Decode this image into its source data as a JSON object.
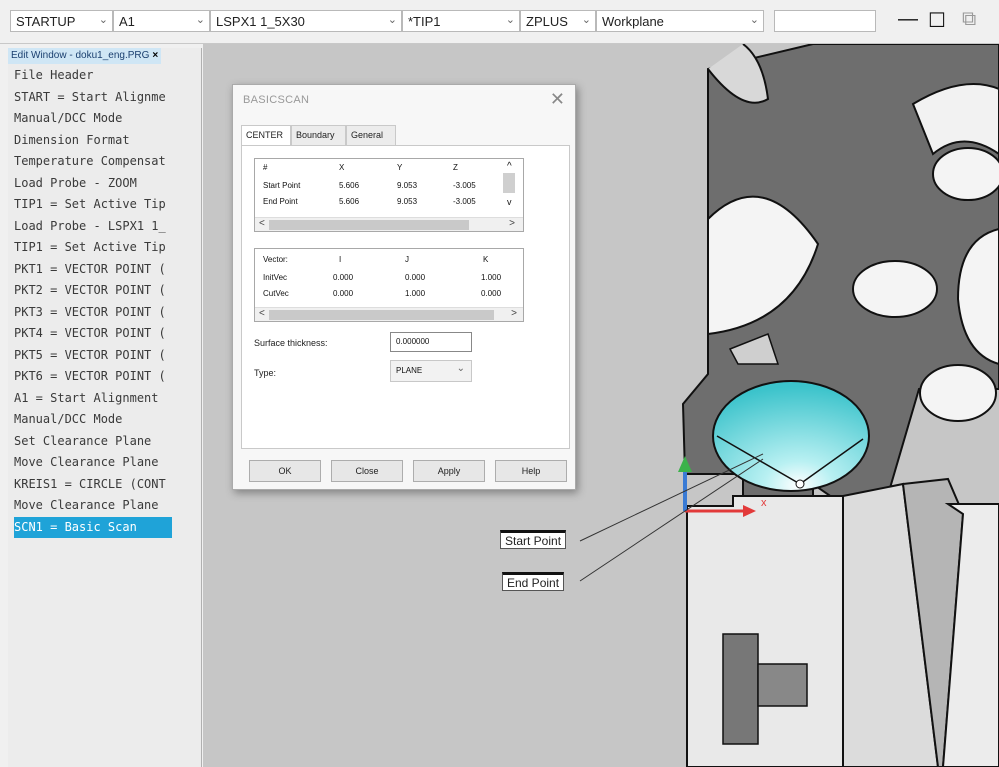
{
  "toolbar": {
    "alignment": "STARTUP",
    "alignment_sub": "A1",
    "probe": "LSPX1 1_5X30",
    "tip": "*TIP1",
    "workplane_axis": "ZPLUS",
    "workplane_label": "Workplane",
    "free_field": "",
    "minimize_glyph": "—",
    "maximize_glyph": "☐",
    "restore_glyph": "⧉"
  },
  "editor": {
    "tab_title": "Edit Window - doku1_eng.PRG",
    "tab_close": "×",
    "lines": [
      "File Header",
      "START = Start Alignme",
      "Manual/DCC Mode",
      "Dimension Format",
      "Temperature Compensat",
      "Load Probe - ZOOM",
      "TIP1 = Set Active Tip",
      "Load Probe - LSPX1 1_",
      "TIP1 = Set Active Tip",
      "PKT1 = VECTOR POINT (",
      "PKT2 = VECTOR POINT (",
      "PKT3 = VECTOR POINT (",
      "PKT4 = VECTOR POINT (",
      "PKT5 = VECTOR POINT (",
      "PKT6 = VECTOR POINT (",
      "A1 = Start Alignment",
      "Manual/DCC Mode",
      "Set Clearance Plane",
      "Move Clearance Plane",
      "KREIS1 = CIRCLE (CONT",
      "Move Clearance Plane",
      "SCN1 = Basic Scan"
    ],
    "selected_index": 21
  },
  "dialog": {
    "title": "BASICSCAN",
    "close": "✕",
    "tabs": [
      "CENTER",
      "Boundary",
      "General"
    ],
    "active_tab": 0,
    "points": {
      "headers": [
        "#",
        "X",
        "Y",
        "Z"
      ],
      "rows": [
        [
          "Start Point",
          "5.606",
          "9.053",
          "-3.005"
        ],
        [
          "End Point",
          "5.606",
          "9.053",
          "-3.005"
        ]
      ]
    },
    "vectors": {
      "headers": [
        "Vector:",
        "I",
        "J",
        "K"
      ],
      "rows": [
        [
          "InitVec",
          "0.000",
          "0.000",
          "1.000"
        ],
        [
          "CutVec",
          "0.000",
          "1.000",
          "0.000"
        ]
      ]
    },
    "surface_thickness_label": "Surface thickness:",
    "surface_thickness_value": "0.000000",
    "type_label": "Type:",
    "type_value": "PLANE",
    "buttons": [
      "OK",
      "Close",
      "Apply",
      "Help"
    ],
    "scroll_left": "<",
    "scroll_right": ">",
    "scroll_up": "^",
    "scroll_down": "v",
    "select_arrow": "⌄"
  },
  "viewport": {
    "start_point_label": "Start Point",
    "end_point_label": "End Point",
    "x_axis_letter": "x",
    "colors": {
      "background": "#c6c6c6",
      "part_gray": "#6e6e6e",
      "part_light": "#e6e6e6",
      "scan_cyan": "#53cfd6",
      "axis_red": "#e23a3a",
      "axis_blue": "#3a7bd5",
      "axis_green": "#3bb24a"
    }
  }
}
